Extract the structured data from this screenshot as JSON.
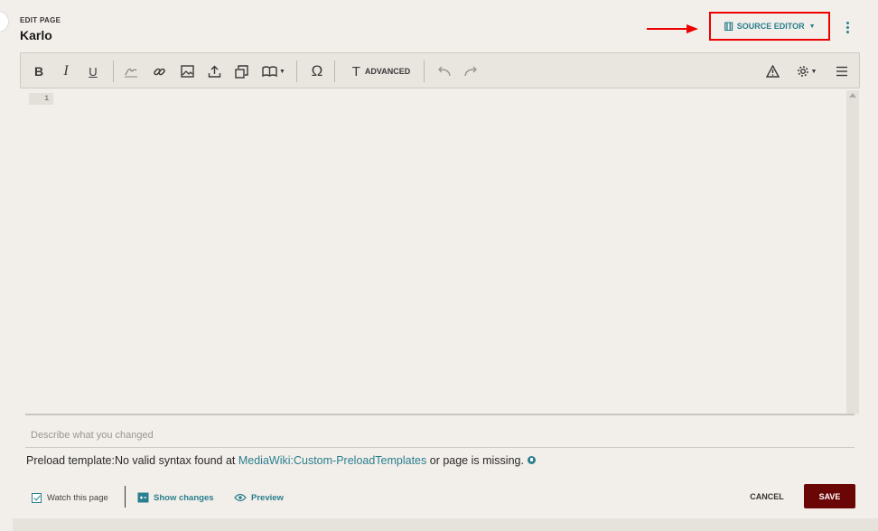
{
  "header": {
    "label": "EDIT PAGE",
    "title": "Karlo"
  },
  "source_editor": {
    "icon": "[[]]",
    "label": "SOURCE EDITOR"
  },
  "toolbar": {
    "bold": "B",
    "italic": "I",
    "underline": "U",
    "advanced_label": "ADVANCED",
    "special_char": "Ω"
  },
  "editor": {
    "line_number": "1"
  },
  "summary": {
    "placeholder": "Describe what you changed"
  },
  "preload": {
    "prefix": "Preload template:No valid syntax found at ",
    "link": "MediaWiki:Custom-PreloadTemplates",
    "suffix": " or page is missing."
  },
  "footer": {
    "watch_label": "Watch this page",
    "show_changes": "Show changes",
    "preview": "Preview",
    "cancel": "CANCEL",
    "save": "SAVE"
  },
  "colors": {
    "accent": "#2a7f8f",
    "save_bg": "#6b0606",
    "highlight": "#e00000",
    "background": "#f2eee9"
  }
}
